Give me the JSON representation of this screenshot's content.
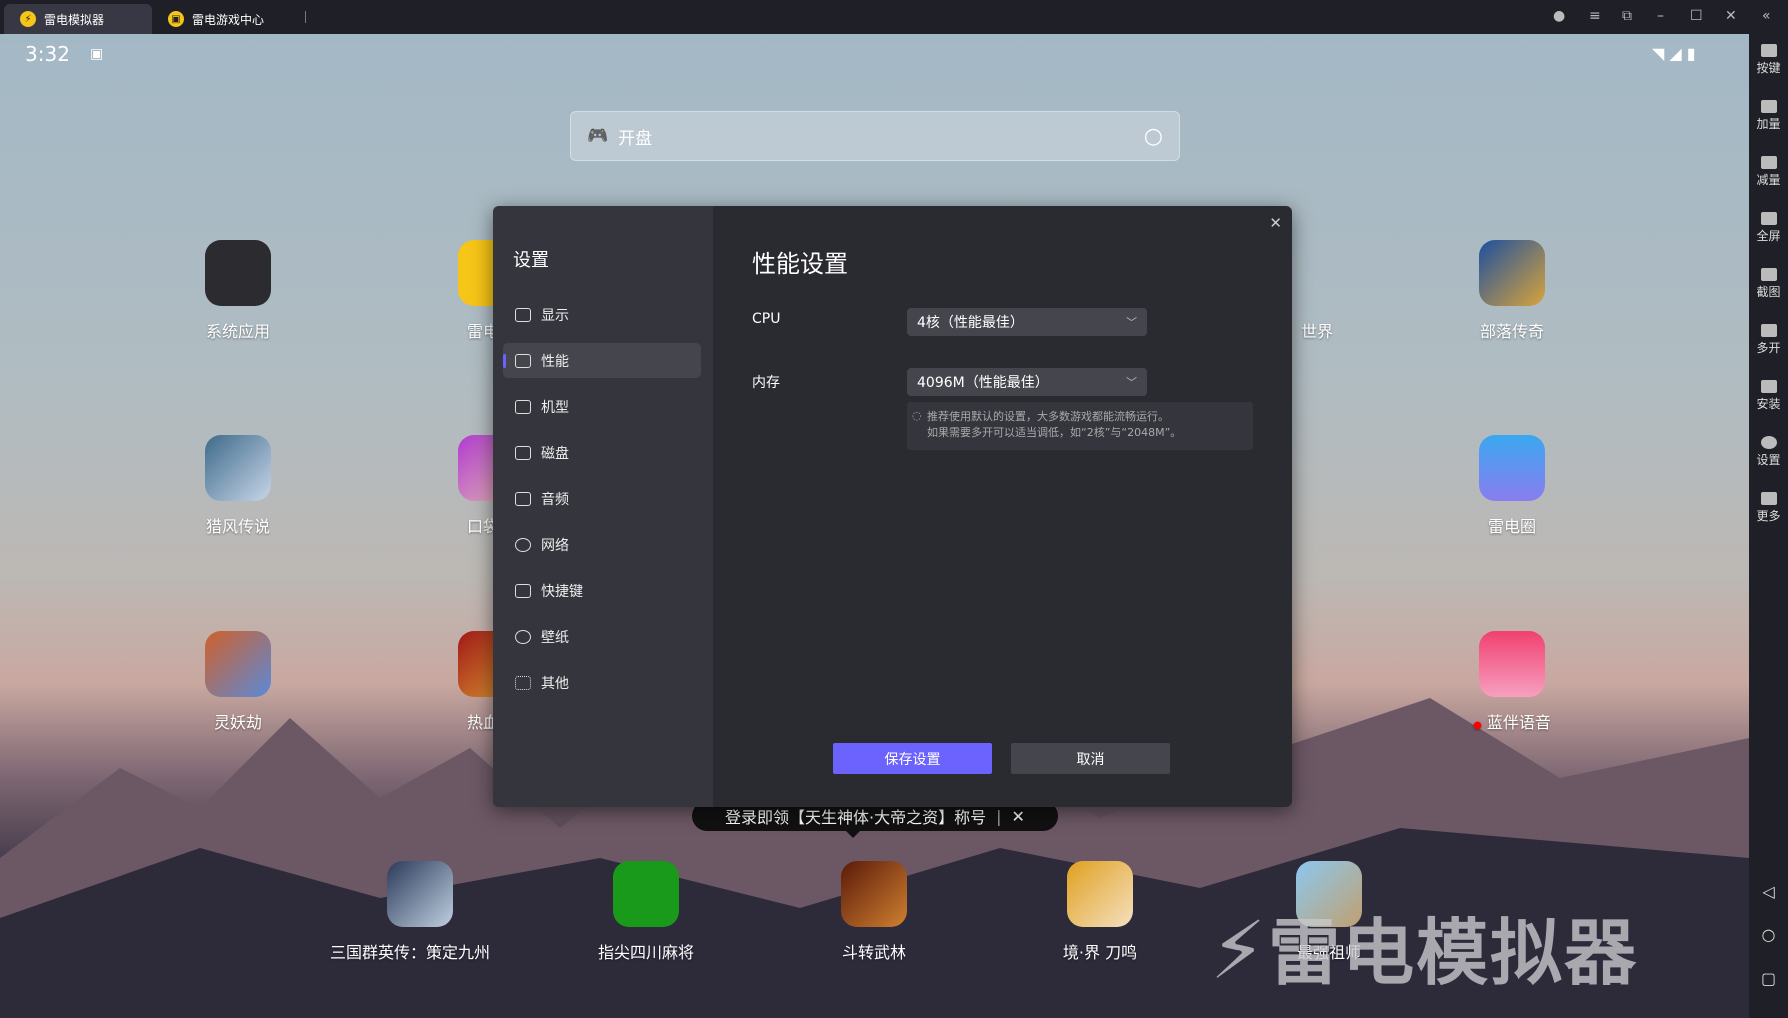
{
  "tabs": [
    {
      "label": "雷电模拟器"
    },
    {
      "label": "雷电游戏中心"
    }
  ],
  "status": {
    "time": "3:32"
  },
  "search": {
    "placeholder": "开盘"
  },
  "apps": [
    {
      "label": "系统应用"
    },
    {
      "label": "雷电游"
    },
    {
      "label": "世界"
    },
    {
      "label": "部落传奇"
    },
    {
      "label": "猎风传说"
    },
    {
      "label": "口袋斗"
    },
    {
      "label": "雷电圈"
    },
    {
      "label": "灵妖劫"
    },
    {
      "label": "热血江"
    },
    {
      "label": "蓝伴语音"
    }
  ],
  "dock": [
    {
      "label": "三国群英传：策定九州"
    },
    {
      "label": "指尖四川麻将"
    },
    {
      "label": "斗转武林"
    },
    {
      "label": "境·界 刀鸣"
    },
    {
      "label": "最强祖师"
    }
  ],
  "tooltip": {
    "text": "登录即领【天生神体·大帝之资】称号",
    "close": "✕"
  },
  "watermark": "雷电模拟器",
  "settings": {
    "title": "设置",
    "nav": [
      {
        "label": "显示"
      },
      {
        "label": "性能"
      },
      {
        "label": "机型"
      },
      {
        "label": "磁盘"
      },
      {
        "label": "音频"
      },
      {
        "label": "网络"
      },
      {
        "label": "快捷键"
      },
      {
        "label": "壁纸"
      },
      {
        "label": "其他"
      }
    ],
    "heading": "性能设置",
    "cpu_label": "CPU",
    "cpu_value": "4核（性能最佳）",
    "mem_label": "内存",
    "mem_value": "4096M（性能最佳）",
    "hint_line1": "推荐使用默认的设置，大多数游戏都能流畅运行。",
    "hint_line2": "如果需要多开可以适当调低，如“2核”与“2048M”。",
    "save": "保存设置",
    "cancel": "取消"
  },
  "sidebar": [
    {
      "label": "按键"
    },
    {
      "label": "加量"
    },
    {
      "label": "减量"
    },
    {
      "label": "全屏"
    },
    {
      "label": "截图"
    },
    {
      "label": "多开"
    },
    {
      "label": "安装"
    },
    {
      "label": "设置"
    },
    {
      "label": "更多"
    }
  ],
  "colors": {
    "accent": "#6c63ff",
    "dialog": "#2a2a31",
    "nav": "#35353d"
  }
}
